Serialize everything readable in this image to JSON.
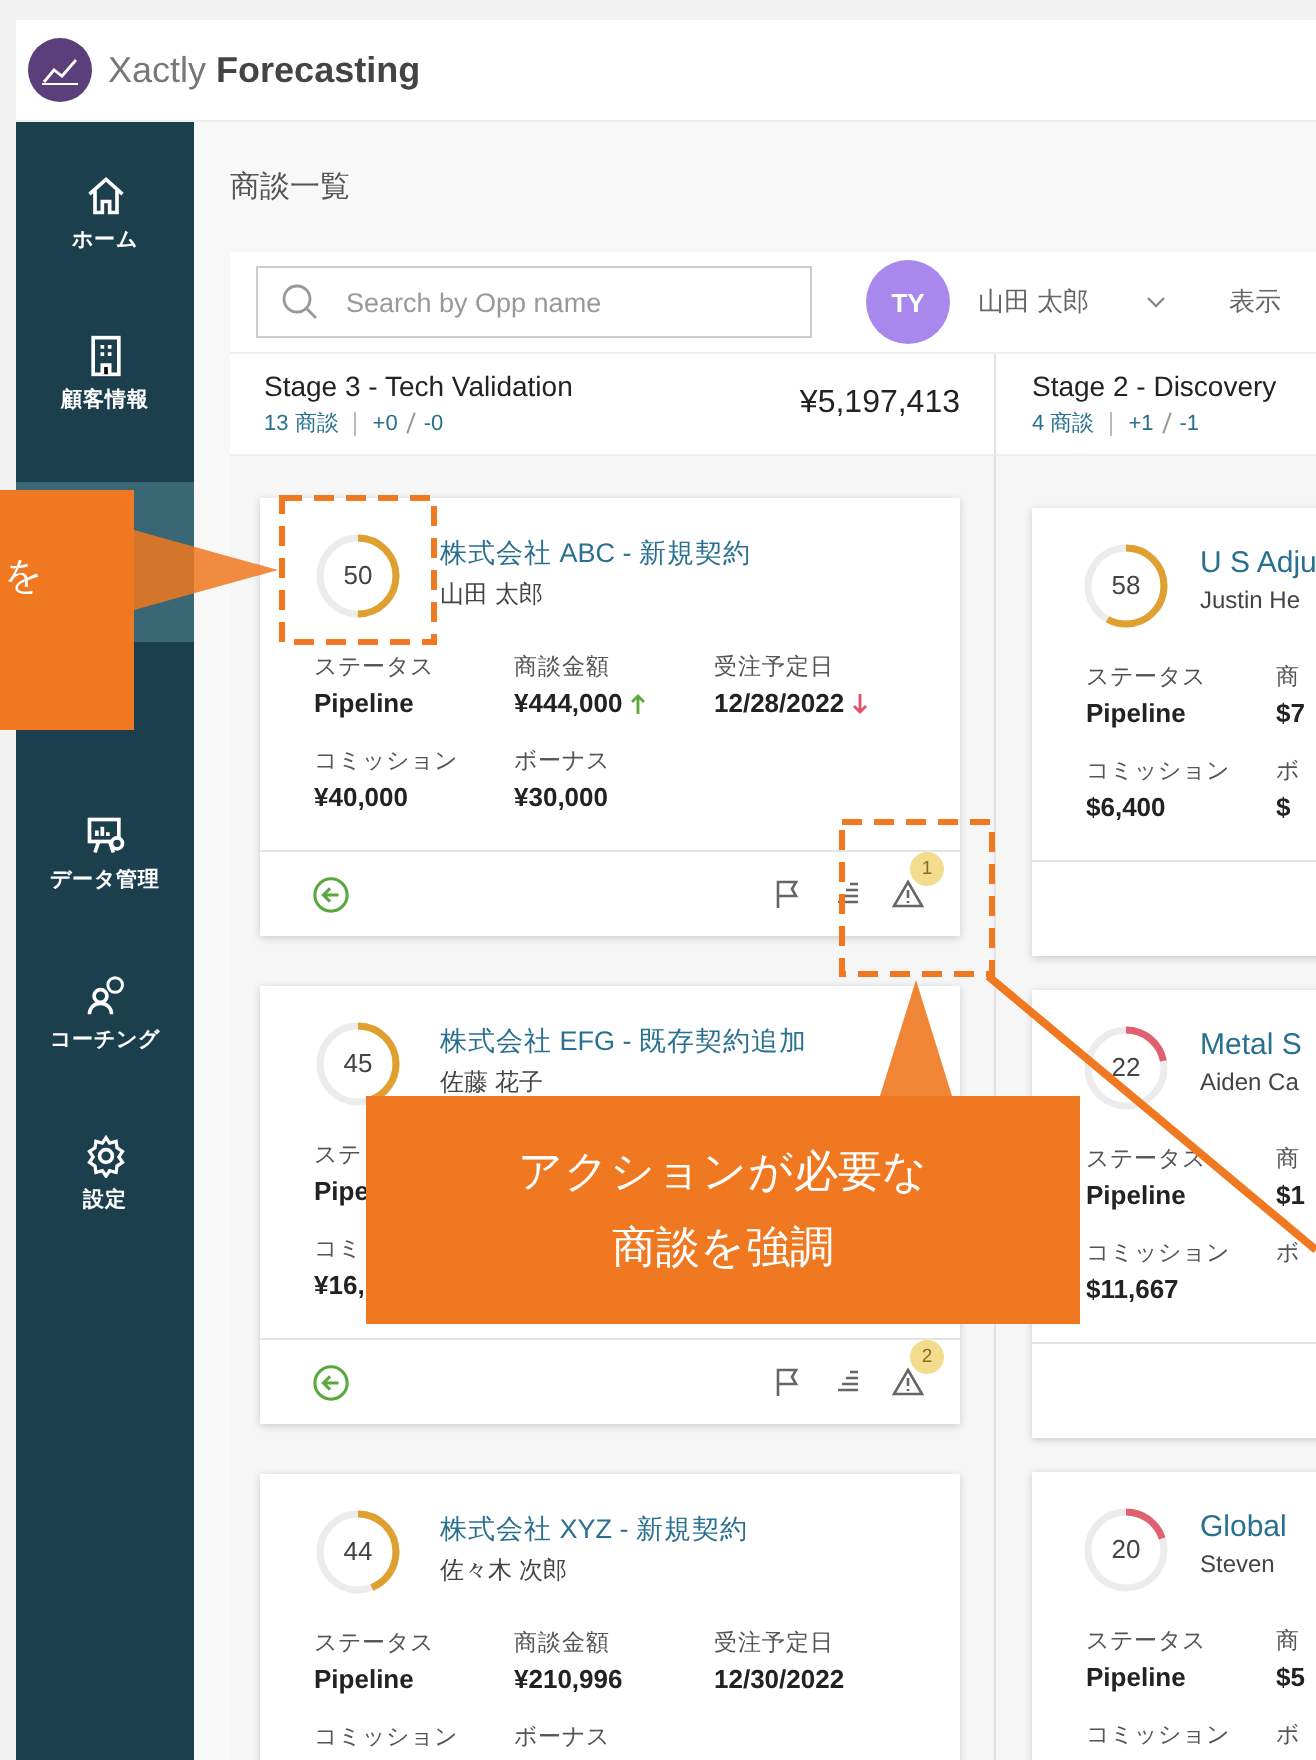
{
  "app": {
    "logo_light": "Xactly",
    "logo_bold": "Forecasting"
  },
  "sidebar": {
    "items": [
      {
        "label": "ホーム",
        "kind": "home",
        "selected": false
      },
      {
        "label": "顧客情報",
        "kind": "building",
        "selected": false
      },
      {
        "label": "データ管理",
        "kind": "data",
        "selected": false
      },
      {
        "label": "コーチング",
        "kind": "coach",
        "selected": false
      },
      {
        "label": "設定",
        "kind": "gear",
        "selected": false
      }
    ]
  },
  "page_title": "商談一覧",
  "toolbar": {
    "search": {
      "placeholder": "Search by Opp name"
    },
    "user": {
      "initials": "TY",
      "name": "山田 太郎"
    },
    "view_label": "表示"
  },
  "columns": [
    {
      "title": "Stage 3 - Tech Validation",
      "count": "13 商談",
      "plus": "+0",
      "minus": "-0",
      "total": "¥5,197,413",
      "cards": [
        {
          "score": "50",
          "level": 0.5,
          "color": "#e0a030",
          "title": "株式会社 ABC - 新規契約",
          "owner": "山田 太郎",
          "rows": [
            [
              {
                "label": "ステータス",
                "value": "Pipeline"
              },
              {
                "label": "商談金額",
                "value": "¥444,000",
                "kind": "rising"
              },
              {
                "label": "受注予定日",
                "value": "12/28/2022",
                "kind": "falling"
              }
            ],
            [
              {
                "label": "コミッション",
                "value": "¥40,000"
              },
              {
                "label": "ボーナス",
                "value": "¥30,000"
              }
            ]
          ],
          "alert_count": "1"
        },
        {
          "score": "45",
          "level": 0.45,
          "color": "#e0a030",
          "title": "株式会社 EFG - 既存契約追加",
          "owner": "佐藤 花子",
          "rows": [
            [
              {
                "label": "ステ",
                "value": "Pipe"
              }
            ],
            [
              {
                "label": "コミ",
                "value": "¥16,"
              }
            ]
          ],
          "alert_count": "2"
        },
        {
          "score": "44",
          "level": 0.44,
          "color": "#e0a030",
          "title": "株式会社 XYZ - 新規契約",
          "owner": "佐々木 次郎",
          "rows": [
            [
              {
                "label": "ステータス",
                "value": "Pipeline"
              },
              {
                "label": "商談金額",
                "value": "¥210,996"
              },
              {
                "label": "受注予定日",
                "value": "12/30/2022"
              }
            ],
            [
              {
                "label": "コミッション"
              },
              {
                "label": "ボーナス"
              }
            ]
          ]
        }
      ]
    },
    {
      "title": "Stage 2 - Discovery",
      "count": "4 商談",
      "plus": "+1",
      "minus": "-1",
      "cards": [
        {
          "score": "58",
          "level": 0.58,
          "color": "#e0a030",
          "title": "U S Adju",
          "owner": "Justin He",
          "rows": [
            [
              {
                "label": "ステータス",
                "value": "Pipeline"
              },
              {
                "label": "商",
                "value": "$7"
              }
            ],
            [
              {
                "label": "コミッション",
                "value": "$6,400"
              },
              {
                "label": "ボ",
                "value": "$"
              }
            ]
          ]
        },
        {
          "score": "22",
          "level": 0.22,
          "color": "#e06070",
          "title": "Metal S",
          "owner": "Aiden Ca",
          "rows": [
            [
              {
                "label": "ステータス",
                "value": "Pipeline"
              },
              {
                "label": "商",
                "value": "$1"
              }
            ],
            [
              {
                "label": "コミッション",
                "value": "$11,667"
              },
              {
                "label": "ボ"
              }
            ]
          ]
        },
        {
          "score": "20",
          "level": 0.2,
          "color": "#e06070",
          "title": "Global",
          "owner": "Steven",
          "rows": [
            [
              {
                "label": "ステータス",
                "value": "Pipeline"
              },
              {
                "label": "商",
                "value": "$5"
              }
            ],
            [
              {
                "label": "コミッション"
              },
              {
                "label": "ボ"
              }
            ]
          ]
        }
      ]
    }
  ],
  "annotations": {
    "left_callout": "を",
    "main_callout": [
      "アクションが必要な",
      "商談を強調"
    ]
  }
}
